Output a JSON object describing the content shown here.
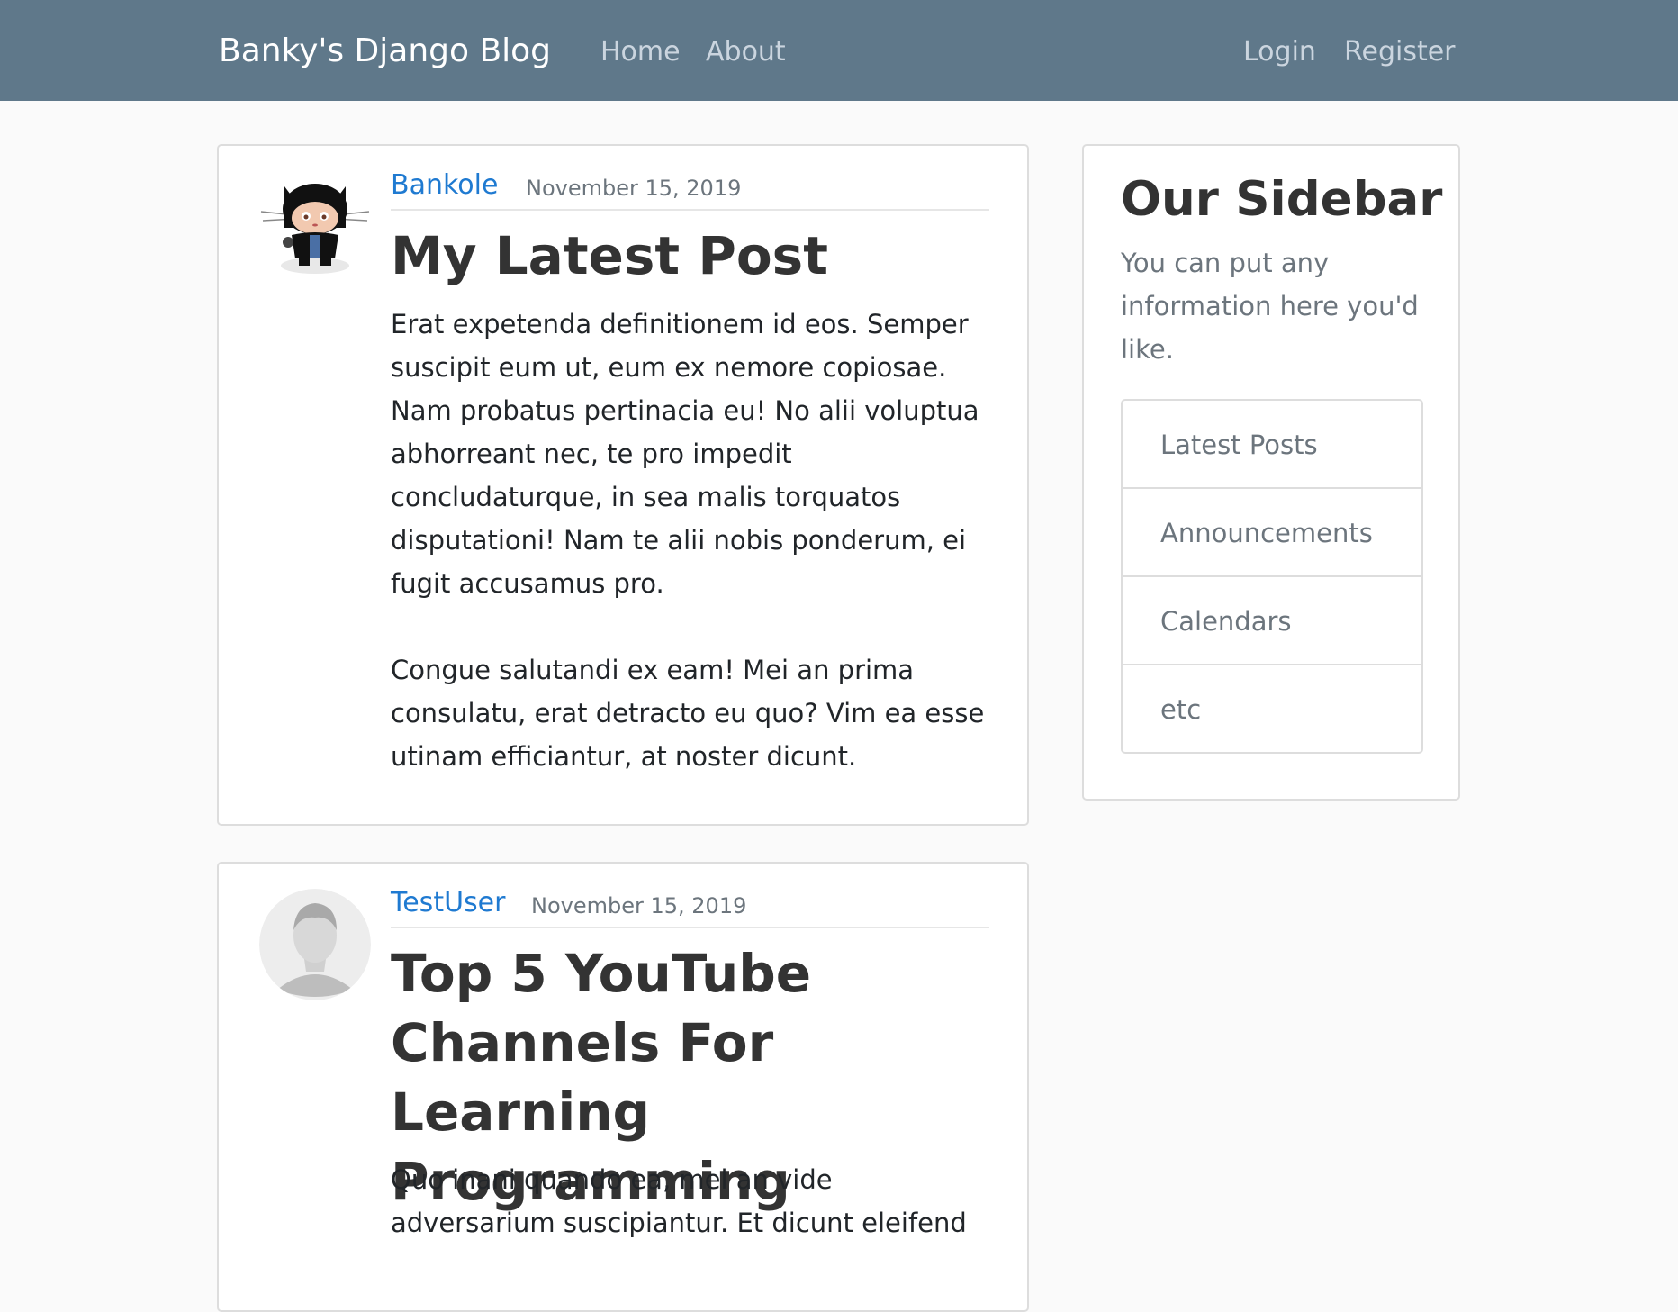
{
  "navbar": {
    "brand": "Banky's Django Blog",
    "links": [
      "Home",
      "About"
    ],
    "auth_links": [
      "Login",
      "Register"
    ]
  },
  "posts": [
    {
      "author": "Bankole",
      "date": "November 15, 2019",
      "title": "My Latest Post",
      "avatar": "octocat-avatar",
      "content": "Erat expetenda definitionem id eos. Semper suscipit eum ut, eum ex nemore copiosae. Nam probatus pertinacia eu! No alii voluptua abhorreant nec, te pro impedit concludaturque, in sea malis torquatos disputationi! Nam te alii nobis ponderum, ei fugit accusamus pro.\n\nCongue salutandi ex eam! Mei an prima consulatu, erat detracto eu quo? Vim ea esse utinam efficiantur, at noster dicunt."
    },
    {
      "author": "TestUser",
      "date": "November 15, 2019",
      "title": "Top 5 YouTube Channels For Learning Programming",
      "avatar": "default-user-avatar",
      "content": "Quo inani quando ea, mel an vide adversarium suscipiantur. Et dicunt eleifend"
    }
  ],
  "sidebar": {
    "title": "Our Sidebar",
    "text": "You can put any information here you'd like.",
    "items": [
      "Latest Posts",
      "Announcements",
      "Calendars",
      "etc"
    ]
  },
  "colors": {
    "navbar": "#5f788a",
    "link": "#1f7ad1",
    "background": "#fafafa"
  }
}
